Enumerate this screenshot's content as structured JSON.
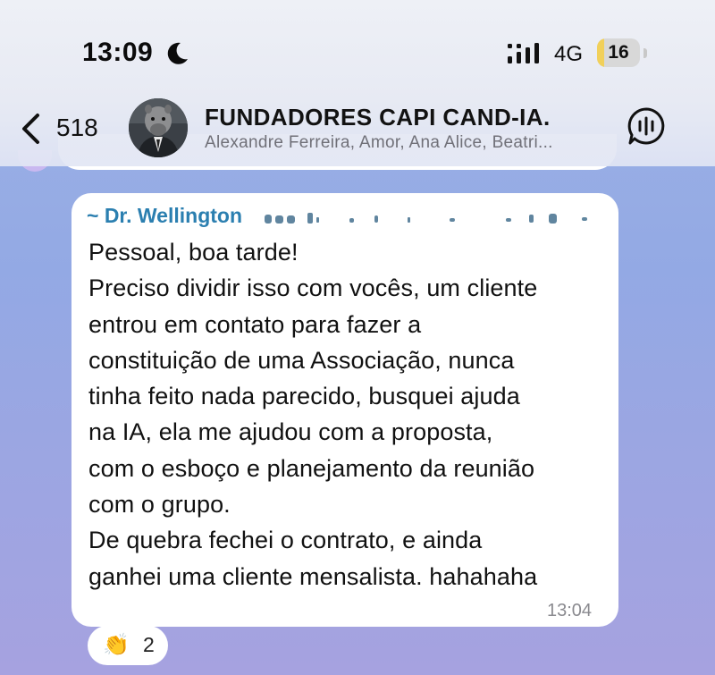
{
  "status_bar": {
    "time": "13:09",
    "network": "4G",
    "battery": "16",
    "battery_level": 0.16,
    "moon_icon": "moon-icon",
    "signal_icon": "signal-bars-icon"
  },
  "header": {
    "back_count": "518",
    "title": "FUNDADORES CAPI CAND-IA.",
    "members": "Alexandre Ferreira, Amor, Ana Alice, Beatri...",
    "back_icon": "chevron-left-icon",
    "call_icon": "voice-chat-icon"
  },
  "message": {
    "sender": "~ Dr. Wellington",
    "lines": [
      "Pessoal, boa tarde!",
      "Preciso dividir isso com vocês, um cliente",
      "entrou em contato para fazer a",
      "constituição de uma Associação, nunca",
      "tinha feito nada parecido, busquei ajuda",
      "na  IA, ela me ajudou com a proposta,",
      "com o esboço e planejamento da reunião",
      "com o grupo.",
      "De quebra fechei o contrato, e ainda",
      "ganhei uma cliente mensalista. hahahaha"
    ],
    "time": "13:04"
  },
  "reaction": {
    "emoji": "👏",
    "count": "2"
  },
  "colors": {
    "sender": "#2b7fb0",
    "battery": "#f1d05a",
    "background": "#9eb3e6"
  }
}
